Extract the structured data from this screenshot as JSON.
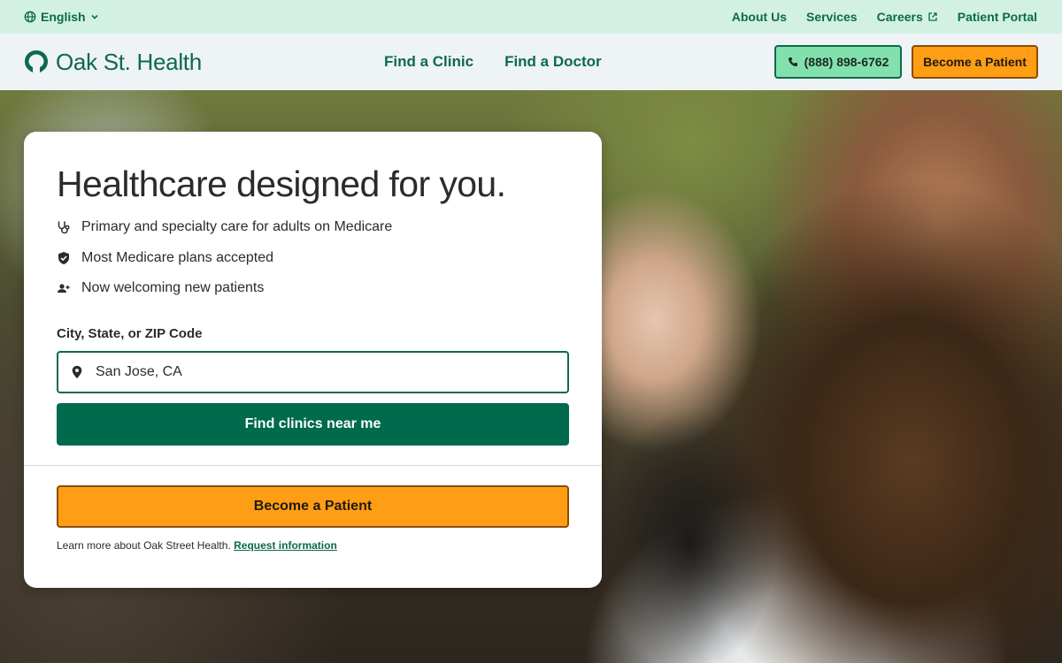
{
  "utility_bar": {
    "language": "English",
    "links": [
      {
        "label": "About Us"
      },
      {
        "label": "Services"
      },
      {
        "label": "Careers"
      },
      {
        "label": "Patient Portal"
      }
    ]
  },
  "header": {
    "logo_text": "Oak St. Health",
    "nav": [
      {
        "label": "Find a Clinic"
      },
      {
        "label": "Find a Doctor"
      }
    ],
    "phone": "(888) 898-6762",
    "become_patient": "Become a Patient"
  },
  "hero_card": {
    "title": "Healthcare designed for you.",
    "features": [
      {
        "icon": "stethoscope-icon",
        "text": "Primary and specialty care for adults on Medicare"
      },
      {
        "icon": "shield-check-icon",
        "text": "Most Medicare plans accepted"
      },
      {
        "icon": "person-add-icon",
        "text": "Now welcoming new patients"
      }
    ],
    "location_label": "City, State, or ZIP Code",
    "location_value": "San Jose, CA",
    "find_button": "Find clinics near me",
    "become_button": "Become a Patient",
    "learn_more_text": "Learn more about Oak Street Health.",
    "request_info_link": "Request information"
  },
  "colors": {
    "brand_green": "#0d6a4a",
    "button_green": "#006a4d",
    "accent_orange": "#ff9e14",
    "utility_bg": "#d2f1e2",
    "phone_button_bg": "#82e0ad"
  }
}
